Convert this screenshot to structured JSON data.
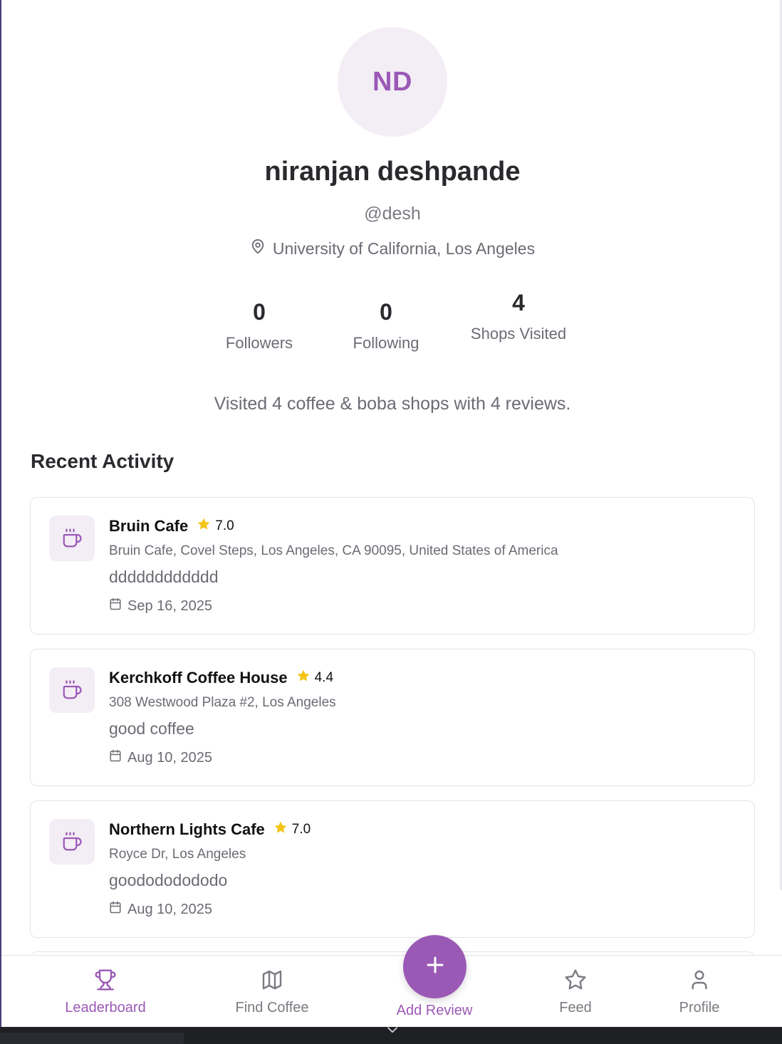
{
  "profile": {
    "initials": "ND",
    "name": "niranjan deshpande",
    "handle": "@desh",
    "location": "University of California, Los Angeles"
  },
  "stats": {
    "followers": {
      "value": "0",
      "label": "Followers"
    },
    "following": {
      "value": "0",
      "label": "Following"
    },
    "shops_visited": {
      "value": "4",
      "label": "Shops Visited"
    }
  },
  "summary": "Visited 4 coffee & boba shops with 4 reviews.",
  "recent_activity": {
    "title": "Recent Activity",
    "items": [
      {
        "shop": "Bruin Cafe",
        "rating": "7.0",
        "address": "Bruin Cafe, Covel Steps, Los Angeles, CA 90095, United States of America",
        "review": "dddddddddddd",
        "date": "Sep 16, 2025"
      },
      {
        "shop": "Kerchkoff Coffee House",
        "rating": "4.4",
        "address": "308 Westwood Plaza #2, Los Angeles",
        "review": "good coffee",
        "date": "Aug 10, 2025"
      },
      {
        "shop": "Northern Lights Cafe",
        "rating": "7.0",
        "address": "Royce Dr, Los Angeles",
        "review": "goodododododo",
        "date": "Aug 10, 2025"
      }
    ]
  },
  "nav": {
    "leaderboard": "Leaderboard",
    "find_coffee": "Find Coffee",
    "add_review": "Add Review",
    "feed": "Feed",
    "profile": "Profile"
  },
  "colors": {
    "accent": "#9b59b6",
    "avatar_bg": "#f3edf6",
    "star": "#f5c518",
    "muted_text": "#6b6b74"
  }
}
